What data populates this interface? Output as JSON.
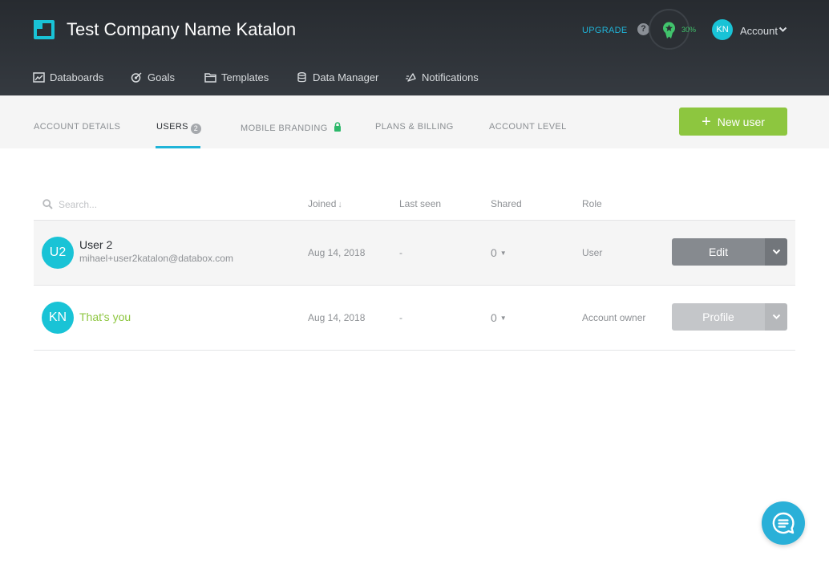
{
  "header": {
    "company_name": "Test Company Name Katalon",
    "upgrade_label": "UPGRADE",
    "help_label": "?",
    "progress_label": "30%",
    "progress_value": 30,
    "avatar_initials": "KN",
    "account_label": "Account",
    "nav": [
      {
        "label": "Databoards",
        "icon": "databoards-icon"
      },
      {
        "label": "Goals",
        "icon": "goals-icon"
      },
      {
        "label": "Templates",
        "icon": "templates-icon"
      },
      {
        "label": "Data Manager",
        "icon": "data-manager-icon"
      },
      {
        "label": "Notifications",
        "icon": "notifications-icon"
      }
    ]
  },
  "tabs": {
    "account_details": "ACCOUNT DETAILS",
    "users": "USERS",
    "users_count": "2",
    "mobile_branding": "MOBILE BRANDING",
    "plans_billing": "PLANS & BILLING",
    "account_level": "ACCOUNT LEVEL",
    "active": "users"
  },
  "new_user_label": "New user",
  "table": {
    "search_placeholder": "Search...",
    "columns": {
      "joined": "Joined",
      "joined_sort": "↓",
      "last_seen": "Last seen",
      "shared": "Shared",
      "role": "Role"
    },
    "rows": [
      {
        "initials": "U2",
        "name": "User 2",
        "email": "mihael+user2katalon@databox.com",
        "joined": "Aug 14, 2018",
        "last_seen": "-",
        "shared": "0",
        "role": "User",
        "action": "Edit"
      },
      {
        "initials": "KN",
        "name": "That's you",
        "joined": "Aug 14, 2018",
        "last_seen": "-",
        "shared": "0",
        "role": "Account owner",
        "action": "Profile"
      }
    ]
  },
  "colors": {
    "accent": "#20b4d8",
    "green": "#8dc63f",
    "avatar": "#19c3d6",
    "header_bg": "#2d3136",
    "edit_button": "#868a8f",
    "profile_button": "#c4c6c9"
  }
}
